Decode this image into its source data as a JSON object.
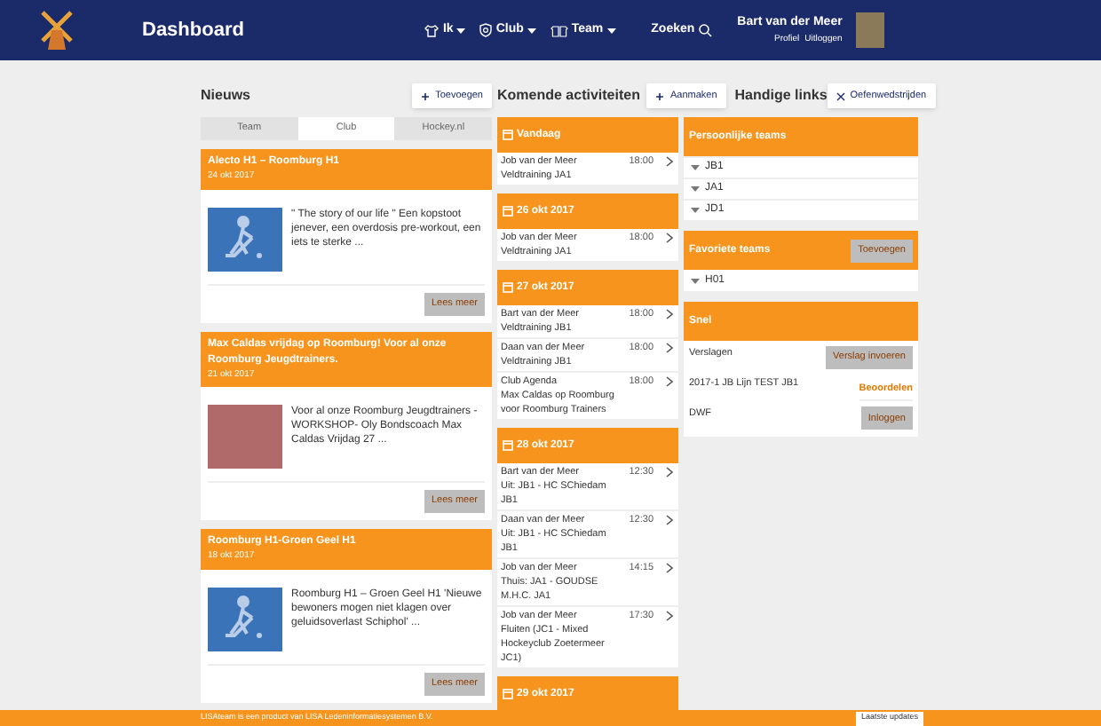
{
  "header": {
    "title": "Dashboard",
    "nav": [
      {
        "label": "Ik",
        "kind": "user"
      },
      {
        "label": "Club",
        "kind": "shield"
      },
      {
        "label": "Team",
        "kind": "team"
      }
    ],
    "search": "Zoeken",
    "user": {
      "name": "Bart van der Meer",
      "links": [
        "Profiel",
        "Uitloggen"
      ]
    }
  },
  "news": {
    "title": "Nieuws",
    "button": "Toevoegen",
    "tabs": [
      {
        "label": "Team",
        "selected": false
      },
      {
        "label": "Club",
        "selected": true
      },
      {
        "label": "Hockey.nl",
        "selected": false
      }
    ],
    "items": [
      {
        "title": "Alecto H1 – Roomburg H1",
        "date": "24 okt 2017",
        "kind": "icon",
        "text": "\" The story of our life \" Een kopstoot jenever, een overdosis pre-workout, een iets te sterke ...",
        "button": "Lees meer"
      },
      {
        "title": "Max Caldas vrijdag op Roomburg! Voor al onze Roomburg Jeugdtrainers.",
        "date": "21 okt 2017",
        "kind": "photo",
        "text": "Voor al onze Roomburg Jeugdtrainers - WORKSHOP- Oly Bondscoach Max Caldas Vrijdag 27 ...",
        "button": "Lees meer"
      },
      {
        "title": "Roomburg H1-Groen Geel H1",
        "date": "18 okt 2017",
        "kind": "icon",
        "text": "Roomburg H1 – Groen Geel H1 'Nieuwe bewoners mogen niet klagen over geluidsoverlast Schiphol' ...",
        "button": "Lees meer"
      }
    ]
  },
  "activities": {
    "title": "Komende activiteiten",
    "button": "Aanmaken",
    "groups": [
      {
        "day": "Vandaag",
        "rows": [
          {
            "name": "Job van der Meer",
            "time": "18:00",
            "detail": "Veldtraining JA1"
          }
        ]
      },
      {
        "day": "26 okt 2017",
        "rows": [
          {
            "name": "Job van der Meer",
            "time": "18:00",
            "detail": "Veldtraining JA1"
          }
        ]
      },
      {
        "day": "27 okt 2017",
        "rows": [
          {
            "name": "Bart van der Meer",
            "time": "18:00",
            "detail": "Veldtraining JB1"
          },
          {
            "name": "Daan van der Meer",
            "time": "18:00",
            "detail": "Veldtraining JB1"
          },
          {
            "name": "Club Agenda",
            "time": "18:00",
            "detail": "Max Caldas op Roomburg voor Roomburg Trainers"
          }
        ]
      },
      {
        "day": "28 okt 2017",
        "rows": [
          {
            "name": "Bart van der Meer",
            "time": "12:30",
            "detail": "Uit: JB1 - HC SChiedam JB1"
          },
          {
            "name": "Daan van der Meer",
            "time": "12:30",
            "detail": "Uit: JB1 - HC SChiedam JB1"
          },
          {
            "name": "Job van der Meer",
            "time": "14:15",
            "detail": "Thuis: JA1 - GOUDSE M.H.C. JA1"
          },
          {
            "name": "Job van der Meer",
            "time": "17:30",
            "detail": "Fluiten (JC1 - Mixed Hockeyclub Zoetermeer JC1)"
          }
        ]
      },
      {
        "day": "29 okt 2017"
      }
    ]
  },
  "links": {
    "title": "Handige links",
    "button": "Oefenwedstrijden",
    "personal": {
      "title": "Persoonlijke teams",
      "teams": [
        "JB1",
        "JA1",
        "JD1"
      ]
    },
    "favorites": {
      "title": "Favoriete teams",
      "button": "Toevoegen",
      "teams": [
        "H01"
      ]
    },
    "quick": {
      "title": "Snel",
      "rows": [
        {
          "label": "Verslagen",
          "action": "Verslag invoeren",
          "kind": "button"
        },
        {
          "label": "2017-1 JB Lijn TEST JB1",
          "action": "Beoordelen",
          "kind": "link"
        },
        {
          "label": "DWF",
          "action": "Inloggen",
          "kind": "button"
        }
      ]
    }
  },
  "footer": {
    "text": "LISAteam is een product van LISA Ledeninformatiesystemen B.V.",
    "button": "Laatste updates"
  }
}
